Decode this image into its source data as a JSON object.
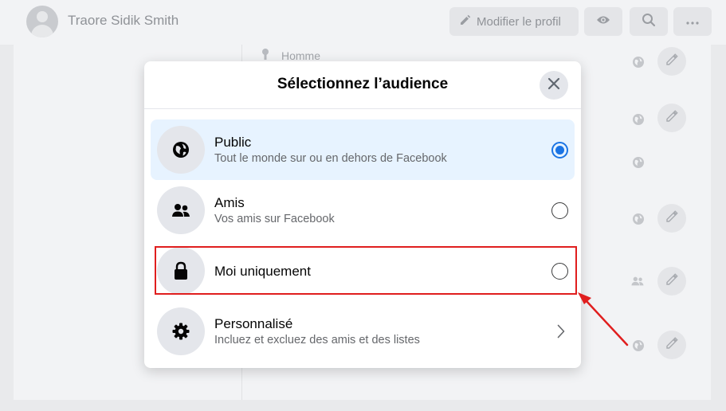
{
  "profile": {
    "name": "Traore Sidik Smith",
    "edit_label": "Modifier le profil"
  },
  "about": {
    "gender": "Homme"
  },
  "dialog": {
    "title": "Sélectionnez l’audience",
    "options": [
      {
        "icon": "globe-icon",
        "title": "Public",
        "subtitle": "Tout le monde sur ou en dehors de Facebook",
        "selected": true
      },
      {
        "icon": "friends-icon",
        "title": "Amis",
        "subtitle": "Vos amis sur Facebook",
        "selected": false
      },
      {
        "icon": "lock-icon",
        "title": "Moi uniquement",
        "subtitle": "",
        "selected": false
      },
      {
        "icon": "gear-icon",
        "title": "Personnalisé",
        "subtitle": "Incluez et excluez des amis et des listes",
        "selected": false
      }
    ]
  },
  "annotation": {
    "highlight_color": "#e01e1e"
  },
  "colors": {
    "accent": "#1b74e4",
    "selected_bg": "#e7f3ff"
  }
}
